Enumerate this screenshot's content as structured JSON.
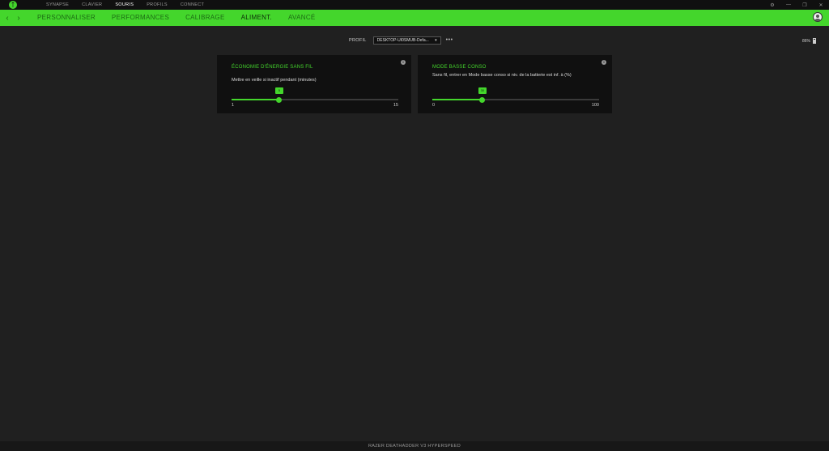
{
  "app": {
    "logo_icon": "razer-logo-icon",
    "accent_color": "#44d62c",
    "background_color": "#202020"
  },
  "topnav": {
    "items": [
      {
        "label": "SYNAPSE",
        "active": false
      },
      {
        "label": "CLAVIER",
        "active": false
      },
      {
        "label": "SOURIS",
        "active": true
      },
      {
        "label": "PROFILS",
        "active": false
      },
      {
        "label": "CONNECT",
        "active": false
      }
    ]
  },
  "window_controls": {
    "settings_icon": "gear-icon",
    "minimize_icon": "minimize-icon",
    "restore_icon": "restore-icon",
    "close_icon": "close-icon"
  },
  "subnav": {
    "back_icon": "chevron-left-icon",
    "forward_icon": "chevron-right-icon",
    "tabs": [
      {
        "label": "PERSONNALISER",
        "active": false
      },
      {
        "label": "PERFORMANCES",
        "active": false
      },
      {
        "label": "CALIBRAGE",
        "active": false
      },
      {
        "label": "ALIMENT.",
        "active": true
      },
      {
        "label": "AVANCÉ",
        "active": false
      }
    ],
    "avatar_icon": "user-avatar-icon"
  },
  "profile": {
    "label": "PROFIL",
    "selected": "DESKTOP-UI0SMUB-Defa...",
    "more_label": "•••"
  },
  "battery": {
    "percent_text": "86%",
    "level": 0.86
  },
  "cards": [
    {
      "title": "ÉCONOMIE D'ÉNERGIE SANS FIL",
      "info_label": "i",
      "description": "Mettre en veille si inactif pendant (minutes)",
      "slider": {
        "min": 1,
        "max": 15,
        "value": 5,
        "value_text": "5",
        "min_text": "1",
        "max_text": "15"
      }
    },
    {
      "title": "MODE BASSE CONSO",
      "info_label": "i",
      "description": "Sans fil, entrer en Mode basse conso si niv. de la batterie est inf. à (%)",
      "slider": {
        "min": 0,
        "max": 100,
        "value": 30,
        "value_text": "30",
        "min_text": "0",
        "max_text": "100"
      }
    }
  ],
  "footer": {
    "device_name": "RAZER DEATHADDER V3 HYPERSPEED"
  }
}
